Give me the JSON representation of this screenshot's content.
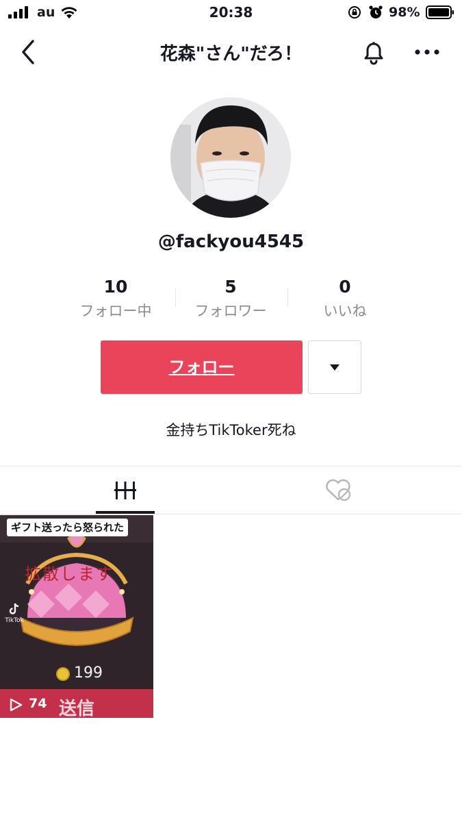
{
  "status_bar": {
    "carrier": "au",
    "time": "20:38",
    "battery_percent": "98%"
  },
  "nav": {
    "title": "花森\"さん\"だろ！"
  },
  "profile": {
    "username": "@fackyou4545",
    "bio": "金持ちTikToker死ね"
  },
  "stats": [
    {
      "value": "10",
      "label": "フォロー中"
    },
    {
      "value": "5",
      "label": "フォロワー"
    },
    {
      "value": "0",
      "label": "いいね"
    }
  ],
  "actions": {
    "follow_label": "フォロー"
  },
  "videos": [
    {
      "caption": "ギフト送ったら怒られた",
      "overlay_text": "拡散します",
      "coin_value": "199",
      "send_label": "送信",
      "play_count": "74",
      "logo_text": "TikTok"
    }
  ],
  "colors": {
    "follow_button": "#ea445a",
    "text_primary": "#161823",
    "text_secondary": "#8a8b91"
  }
}
